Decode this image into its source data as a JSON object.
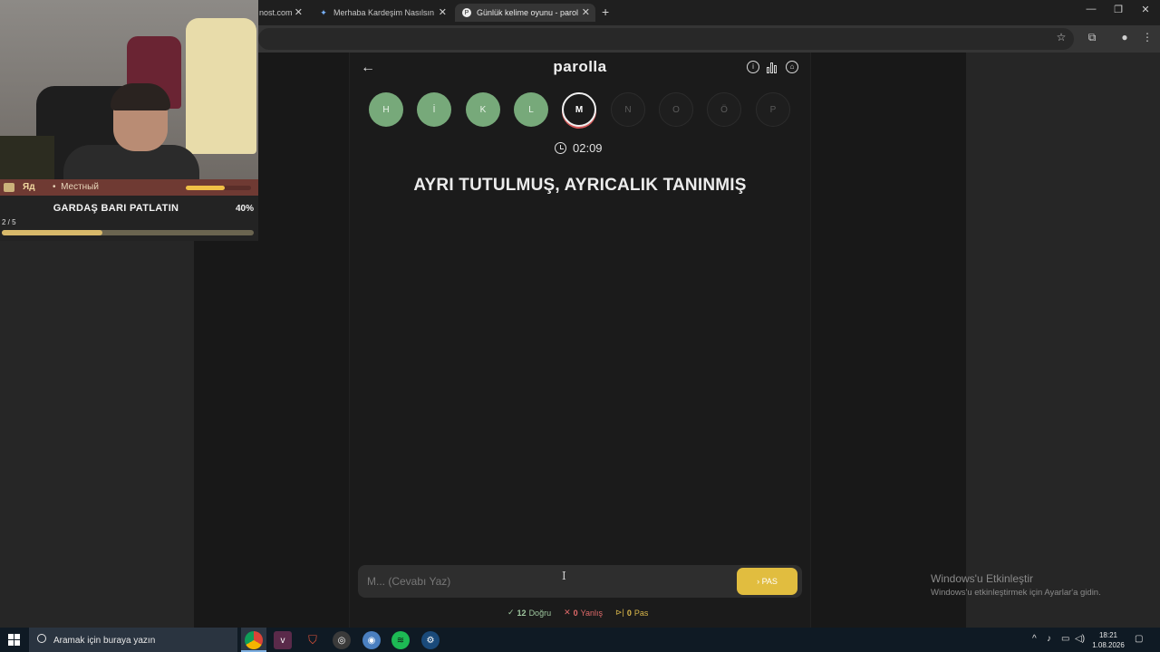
{
  "browser": {
    "tabs": [
      {
        "title": "nost.com",
        "active": false
      },
      {
        "title": "Merhaba Kardeşim Nasılsın Diy",
        "active": false
      },
      {
        "title": "Günlük kelime oyunu - parolla",
        "active": true
      }
    ],
    "new_tab": "+",
    "controls": {
      "minimize": "—",
      "restore": "❐",
      "close": "✕"
    }
  },
  "game": {
    "logo": "parolla",
    "back": "←",
    "letters": [
      {
        "char": "H",
        "state": "done"
      },
      {
        "char": "İ",
        "state": "done"
      },
      {
        "char": "K",
        "state": "done"
      },
      {
        "char": "L",
        "state": "done"
      },
      {
        "char": "M",
        "state": "current"
      },
      {
        "char": "N",
        "state": "pending"
      },
      {
        "char": "O",
        "state": "pending"
      },
      {
        "char": "Ö",
        "state": "pending"
      },
      {
        "char": "P",
        "state": "pending"
      }
    ],
    "timer": "02:09",
    "question": "AYRI TUTULMUŞ, AYRICALIK TANINMIŞ",
    "answer_placeholder": "M... (Cevabı Yaz)",
    "pass_button": "› PAS",
    "stats": {
      "correct": {
        "icon": "✓",
        "count": "12",
        "label": "Doğru",
        "color": "#9fc79f"
      },
      "wrong": {
        "icon": "✕",
        "count": "0",
        "label": "Yanlış",
        "color": "#e06a6a"
      },
      "pass": {
        "icon": "⊳|",
        "count": "0",
        "label": "Pas",
        "color": "#d8b64a"
      }
    }
  },
  "stream_overlay": {
    "rank_label": "Яд",
    "separator": "•",
    "role": "Местный",
    "rank_progress": 0.6,
    "goal_title": "GARDAŞ BARI PATLATIN",
    "goal_percent": "40%",
    "goal_count": "2 / 5",
    "goal_progress": 0.4
  },
  "windows": {
    "watermark_title": "Windows'u Etkinleştir",
    "watermark_sub": "Windows'u etkinleştirmek için Ayarlar'a gidin.",
    "search_placeholder": "Aramak için buraya yazın",
    "time": "18:21",
    "date": "1.08.2026"
  }
}
